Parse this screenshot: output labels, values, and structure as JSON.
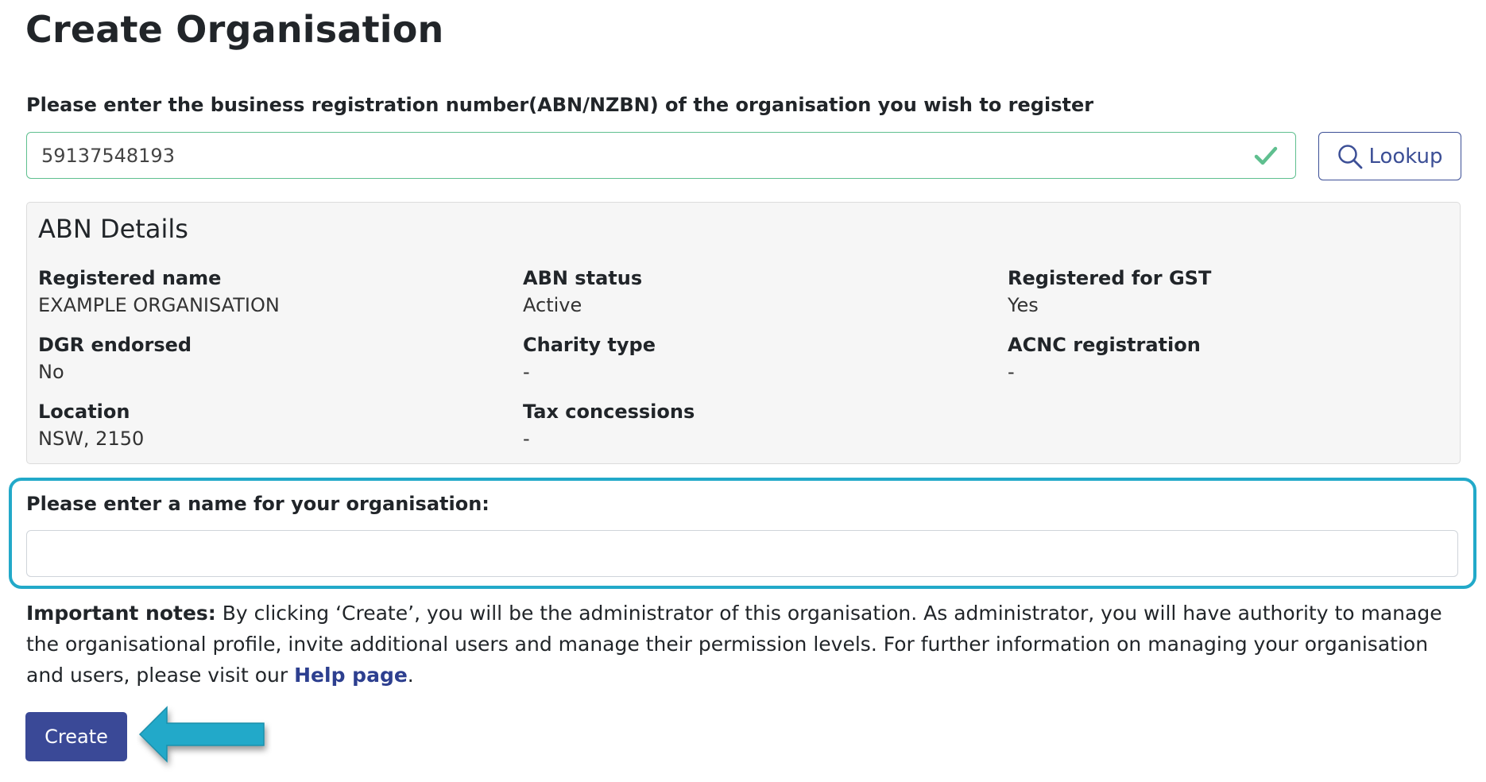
{
  "page": {
    "title": "Create Organisation"
  },
  "abn_lookup": {
    "label": "Please enter the business registration number(ABN/NZBN) of the organisation you wish to register",
    "value": "59137548193",
    "lookup_label": "Lookup"
  },
  "abn_details": {
    "title": "ABN Details",
    "fields": [
      {
        "label": "Registered name",
        "value": "EXAMPLE ORGANISATION"
      },
      {
        "label": "ABN status",
        "value": "Active"
      },
      {
        "label": "Registered for GST",
        "value": "Yes"
      },
      {
        "label": "DGR endorsed",
        "value": "No"
      },
      {
        "label": "Charity type",
        "value": "-"
      },
      {
        "label": "ACNC registration",
        "value": "-"
      },
      {
        "label": "Location",
        "value": "NSW, 2150"
      },
      {
        "label": "Tax concessions",
        "value": "-"
      }
    ]
  },
  "org_name": {
    "label": "Please enter a name for your organisation:",
    "value": ""
  },
  "notes": {
    "strong": "Important notes:",
    "text": " By clicking ‘Create’, you will be the administrator of this organisation. As administrator, you will have authority to manage the organisational profile, invite additional users and manage their permission levels. For further information on managing your organisation and users, please visit our ",
    "link": "Help page",
    "end": "."
  },
  "actions": {
    "create_label": "Create"
  },
  "icons": {
    "check": "check-icon",
    "search": "search-icon",
    "arrow": "arrow-left-icon"
  },
  "colors": {
    "primary": "#3a4997",
    "valid": "#5fbf8f",
    "highlight": "#22a9c9"
  }
}
